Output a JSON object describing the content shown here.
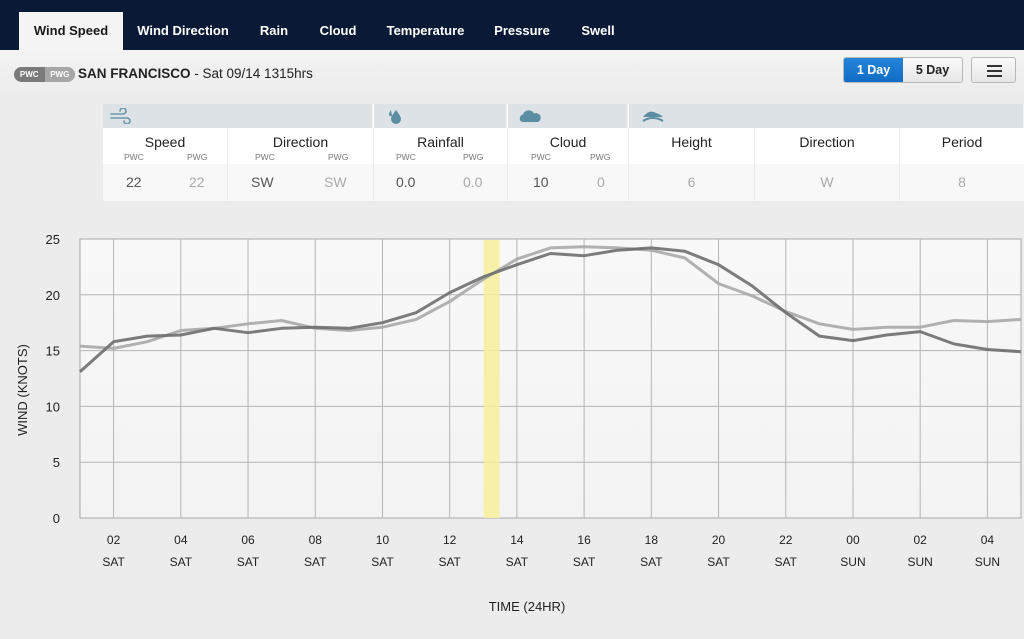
{
  "nav": {
    "tabs": [
      {
        "label": "Wind Speed",
        "active": true
      },
      {
        "label": "Wind Direction",
        "active": false
      },
      {
        "label": "Rain",
        "active": false
      },
      {
        "label": "Cloud",
        "active": false
      },
      {
        "label": "Temperature",
        "active": false
      },
      {
        "label": "Pressure",
        "active": false
      },
      {
        "label": "Swell",
        "active": false
      }
    ]
  },
  "location": {
    "badges": [
      "PWC",
      "PWG"
    ],
    "name": "SAN FRANCISCO",
    "datetime": " - Sat 09/14 1315hrs"
  },
  "controls": {
    "day_options": [
      {
        "label": "1 Day",
        "active": true
      },
      {
        "label": "5 Day",
        "active": false
      }
    ],
    "menu_icon": "hamburger-icon"
  },
  "summary": {
    "groups": [
      {
        "icon": "wind-icon"
      },
      {
        "icon": "raindrop-icon"
      },
      {
        "icon": "cloud-icon"
      },
      {
        "icon": "swell-wave-icon"
      }
    ],
    "columns": [
      {
        "title": "Speed",
        "sub": [
          "PWC",
          "PWG"
        ],
        "values": [
          "22",
          "22"
        ]
      },
      {
        "title": "Direction",
        "sub": [
          "PWC",
          "PWG"
        ],
        "values": [
          "SW",
          "SW"
        ]
      },
      {
        "title": "Rainfall",
        "sub": [
          "PWC",
          "PWG"
        ],
        "values": [
          "0.0",
          "0.0"
        ]
      },
      {
        "title": "Cloud",
        "sub": [
          "PWC",
          "PWG"
        ],
        "values": [
          "10",
          "0"
        ]
      },
      {
        "title": "Height",
        "values": [
          "6"
        ]
      },
      {
        "title": "Direction",
        "values": [
          "W"
        ]
      },
      {
        "title": "Period",
        "values": [
          "8"
        ]
      }
    ]
  },
  "chart_data": {
    "type": "line",
    "title": "",
    "xlabel": "TIME (24HR)",
    "ylabel": "WIND (KNOTS)",
    "ylim": [
      0,
      25
    ],
    "yticks": [
      0,
      5,
      10,
      15,
      20,
      25
    ],
    "grid": true,
    "x_hours": [
      1,
      2,
      3,
      4,
      5,
      6,
      7,
      8,
      9,
      10,
      11,
      12,
      13,
      14,
      15,
      16,
      17,
      18,
      19,
      20,
      21,
      22,
      23,
      24,
      25,
      26,
      27,
      28,
      29
    ],
    "xlim_hours": [
      1,
      29
    ],
    "xticks": [
      {
        "hour": 2,
        "label": "02",
        "day": "SAT"
      },
      {
        "hour": 4,
        "label": "04",
        "day": "SAT"
      },
      {
        "hour": 6,
        "label": "06",
        "day": "SAT"
      },
      {
        "hour": 8,
        "label": "08",
        "day": "SAT"
      },
      {
        "hour": 10,
        "label": "10",
        "day": "SAT"
      },
      {
        "hour": 12,
        "label": "12",
        "day": "SAT"
      },
      {
        "hour": 14,
        "label": "14",
        "day": "SAT"
      },
      {
        "hour": 16,
        "label": "16",
        "day": "SAT"
      },
      {
        "hour": 18,
        "label": "18",
        "day": "SAT"
      },
      {
        "hour": 20,
        "label": "20",
        "day": "SAT"
      },
      {
        "hour": 22,
        "label": "22",
        "day": "SAT"
      },
      {
        "hour": 24,
        "label": "00",
        "day": "SUN"
      },
      {
        "hour": 26,
        "label": "02",
        "day": "SUN"
      },
      {
        "hour": 28,
        "label": "04",
        "day": "SUN"
      }
    ],
    "current_time_hour": 13.25,
    "current_time_color": "#f7ef9a",
    "series": [
      {
        "name": "PWC",
        "color": "#6e6e6e",
        "values": [
          13.1,
          15.8,
          16.3,
          16.4,
          17.0,
          16.6,
          17.0,
          17.1,
          17.0,
          17.5,
          18.4,
          20.2,
          21.6,
          22.7,
          23.7,
          23.5,
          24.0,
          24.2,
          23.9,
          22.7,
          20.8,
          18.4,
          16.3,
          15.9,
          16.4,
          16.7,
          15.6,
          15.1,
          14.9
        ]
      },
      {
        "name": "PWG",
        "color": "#a8a8a8",
        "values": [
          15.4,
          15.2,
          15.8,
          16.8,
          17.0,
          17.4,
          17.7,
          17.0,
          16.8,
          17.1,
          17.8,
          19.4,
          21.4,
          23.2,
          24.2,
          24.3,
          24.2,
          24.0,
          23.3,
          21.0,
          19.9,
          18.5,
          17.4,
          16.9,
          17.1,
          17.1,
          17.7,
          17.6,
          17.8
        ]
      }
    ]
  }
}
